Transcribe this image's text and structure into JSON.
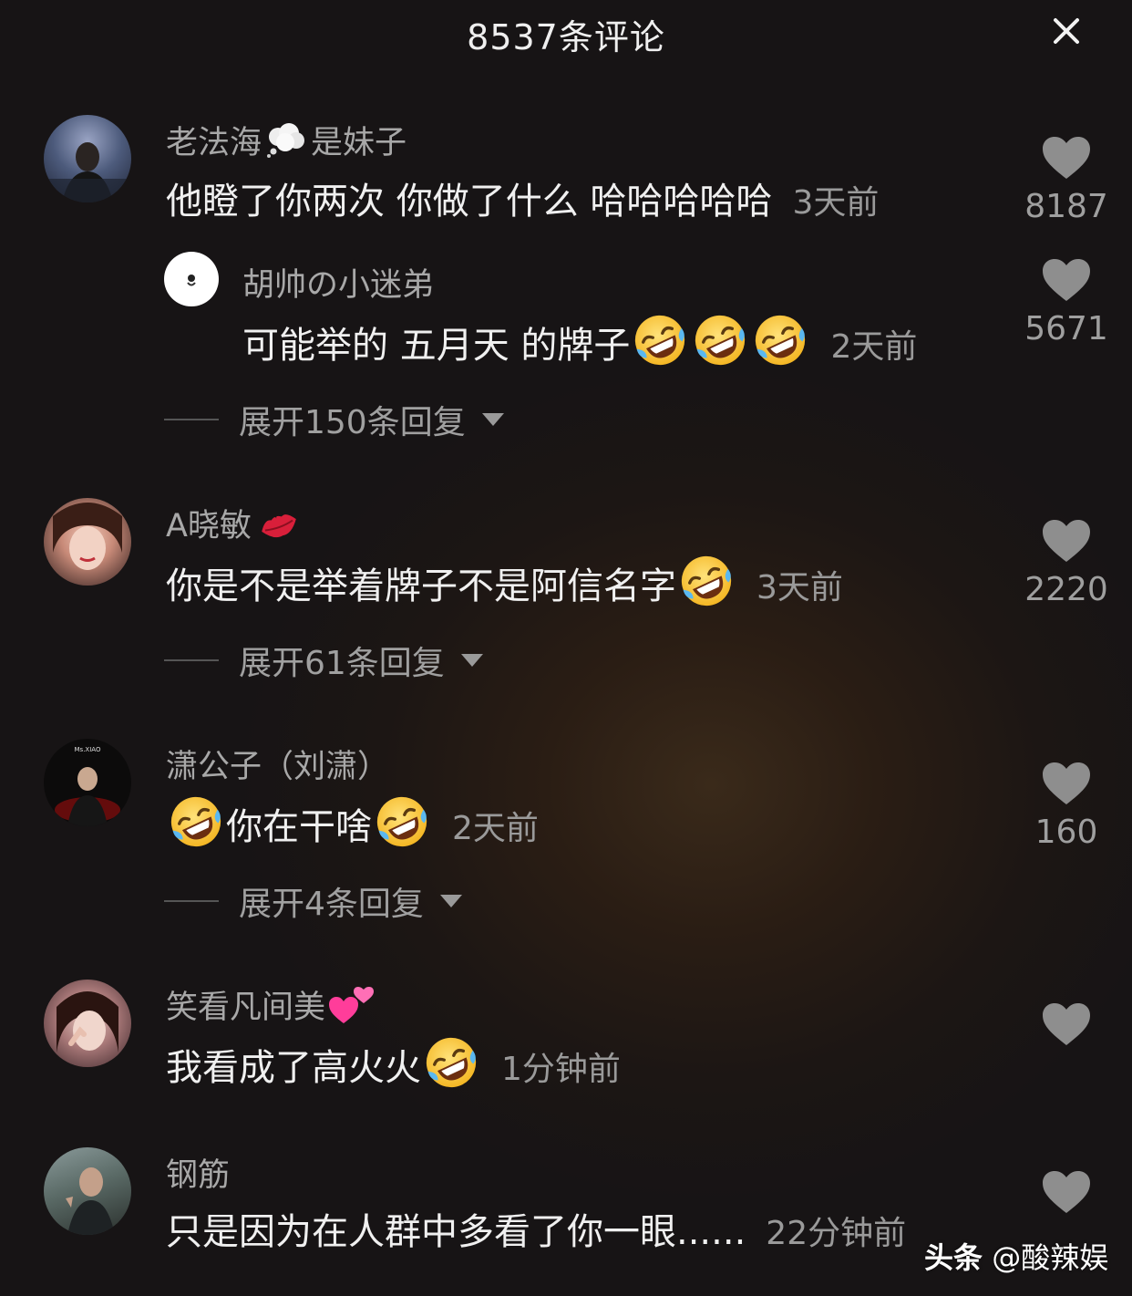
{
  "header": {
    "title": "8537条评论",
    "close_icon": "close-icon"
  },
  "comments": [
    {
      "username": "老法海",
      "username_suffix": "是妹子",
      "text": "他瞪了你两次 你做了什么 哈哈哈哈哈",
      "time": "3天前",
      "likes": "8187",
      "reply": {
        "username": "胡帅の小迷弟",
        "text": "可能举的 五月天 的牌子",
        "time": "2天前",
        "likes": "5671"
      },
      "expand": "展开150条回复"
    },
    {
      "username": "A晓敏",
      "text": "你是不是举着牌子不是阿信名字",
      "time": "3天前",
      "likes": "2220",
      "expand": "展开61条回复"
    },
    {
      "username": "潇公子（刘潇）",
      "text": "你在干啥",
      "time": "2天前",
      "likes": "160",
      "expand": "展开4条回复",
      "avatar_caption": "Ms.XIAO"
    },
    {
      "username": "笑看凡间美",
      "text": "我看成了高火火",
      "time": "1分钟前"
    },
    {
      "username": "钢筋",
      "text": "只是因为在人群中多看了你一眼......",
      "time": "22分钟前"
    }
  ],
  "watermark": {
    "brand": "头条",
    "handle": "@酸辣娱"
  },
  "colors": {
    "background": "#181516",
    "username": "#a8a8a8",
    "text": "#f0f0f0",
    "meta": "#9a9a9a"
  }
}
